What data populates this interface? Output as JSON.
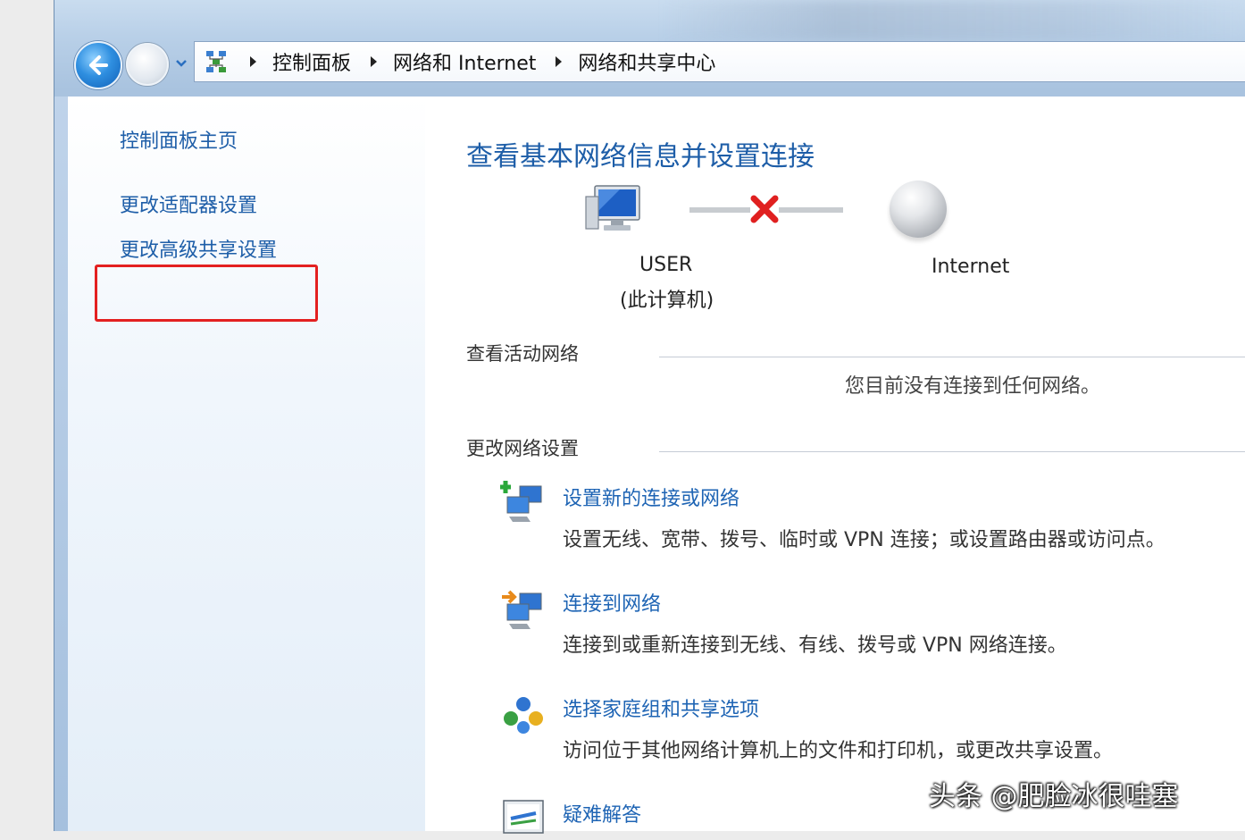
{
  "breadcrumb": {
    "items": [
      "控制面板",
      "网络和 Internet",
      "网络和共享中心"
    ]
  },
  "sidebar": {
    "home_link": "控制面板主页",
    "items": [
      {
        "label": "更改适配器设置",
        "highlighted": true
      },
      {
        "label": "更改高级共享设置",
        "highlighted": false
      }
    ]
  },
  "main": {
    "title": "查看基本网络信息并设置连接",
    "network_map": {
      "computer_name": "USER",
      "computer_subtitle": "(此计算机)",
      "internet_label": "Internet",
      "status_icon": "red-x-icon"
    },
    "active_networks": {
      "heading": "查看活动网络",
      "message": "您目前没有连接到任何网络。"
    },
    "change_settings": {
      "heading": "更改网络设置",
      "tasks": [
        {
          "label": "设置新的连接或网络",
          "description": "设置无线、宽带、拨号、临时或 VPN 连接；或设置路由器或访问点。",
          "icon": "new-connection-icon"
        },
        {
          "label": "连接到网络",
          "description": "连接到或重新连接到无线、有线、拨号或 VPN 网络连接。",
          "icon": "connect-network-icon"
        },
        {
          "label": "选择家庭组和共享选项",
          "description": "访问位于其他网络计算机上的文件和打印机，或更改共享设置。",
          "icon": "homegroup-icon"
        },
        {
          "label": "疑难解答",
          "description": "",
          "icon": "troubleshoot-icon"
        }
      ]
    }
  },
  "watermark": "头条 @肥脸冰很哇塞",
  "colors": {
    "link": "#1e5ea8",
    "highlight_border": "#e32020",
    "error_x": "#e02020"
  }
}
